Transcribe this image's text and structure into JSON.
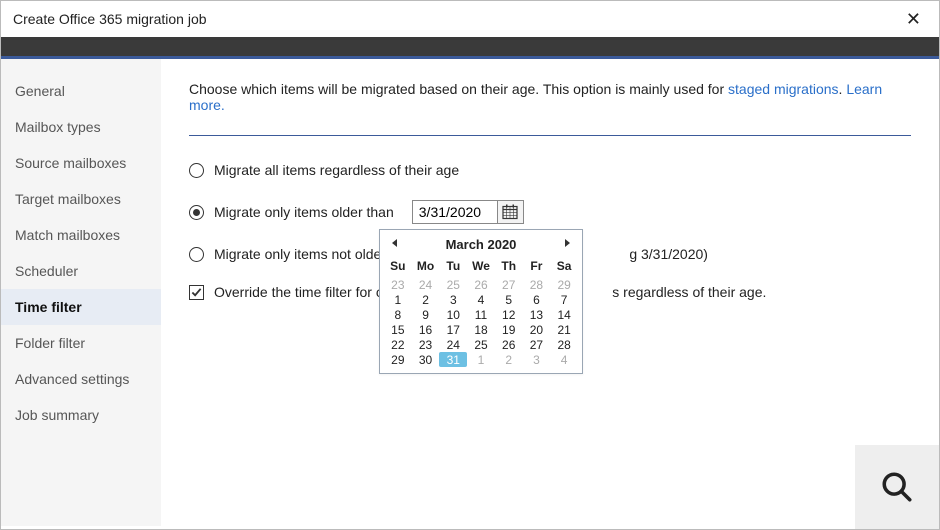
{
  "titlebar": {
    "title": "Create Office 365 migration job"
  },
  "sidebar": {
    "items": [
      {
        "label": "General"
      },
      {
        "label": "Mailbox types"
      },
      {
        "label": "Source mailboxes"
      },
      {
        "label": "Target mailboxes"
      },
      {
        "label": "Match mailboxes"
      },
      {
        "label": "Scheduler"
      },
      {
        "label": "Time filter",
        "active": true
      },
      {
        "label": "Folder filter"
      },
      {
        "label": "Advanced settings"
      },
      {
        "label": "Job summary"
      }
    ]
  },
  "content": {
    "intro_prefix": "Choose which items will be migrated based on their age. This option is mainly used for ",
    "staged_link": "staged migrations",
    "intro_sep": ". ",
    "learn_more": "Learn more.",
    "options": {
      "all_items": "Migrate all items regardless of their age",
      "older_than": "Migrate only items older than",
      "not_older_prefix": "Migrate only items not older tha",
      "not_older_suffix": "g 3/31/2020)",
      "override_prefix": "Override the time filter for cont",
      "override_suffix": "s regardless of their age."
    },
    "date_value": "3/31/2020"
  },
  "calendar": {
    "title": "March 2020",
    "dow": [
      "Su",
      "Mo",
      "Tu",
      "We",
      "Th",
      "Fr",
      "Sa"
    ],
    "rows": [
      [
        {
          "n": 23,
          "o": true
        },
        {
          "n": 24,
          "o": true
        },
        {
          "n": 25,
          "o": true
        },
        {
          "n": 26,
          "o": true
        },
        {
          "n": 27,
          "o": true
        },
        {
          "n": 28,
          "o": true
        },
        {
          "n": 29,
          "o": true
        }
      ],
      [
        {
          "n": 1
        },
        {
          "n": 2
        },
        {
          "n": 3
        },
        {
          "n": 4
        },
        {
          "n": 5
        },
        {
          "n": 6
        },
        {
          "n": 7
        }
      ],
      [
        {
          "n": 8
        },
        {
          "n": 9
        },
        {
          "n": 10
        },
        {
          "n": 11
        },
        {
          "n": 12
        },
        {
          "n": 13
        },
        {
          "n": 14
        }
      ],
      [
        {
          "n": 15
        },
        {
          "n": 16
        },
        {
          "n": 17
        },
        {
          "n": 18
        },
        {
          "n": 19
        },
        {
          "n": 20
        },
        {
          "n": 21
        }
      ],
      [
        {
          "n": 22
        },
        {
          "n": 23
        },
        {
          "n": 24
        },
        {
          "n": 25
        },
        {
          "n": 26
        },
        {
          "n": 27
        },
        {
          "n": 28
        }
      ],
      [
        {
          "n": 29
        },
        {
          "n": 30
        },
        {
          "n": 31,
          "sel": true
        },
        {
          "n": 1,
          "o": true
        },
        {
          "n": 2,
          "o": true
        },
        {
          "n": 3,
          "o": true
        },
        {
          "n": 4,
          "o": true
        }
      ]
    ]
  }
}
